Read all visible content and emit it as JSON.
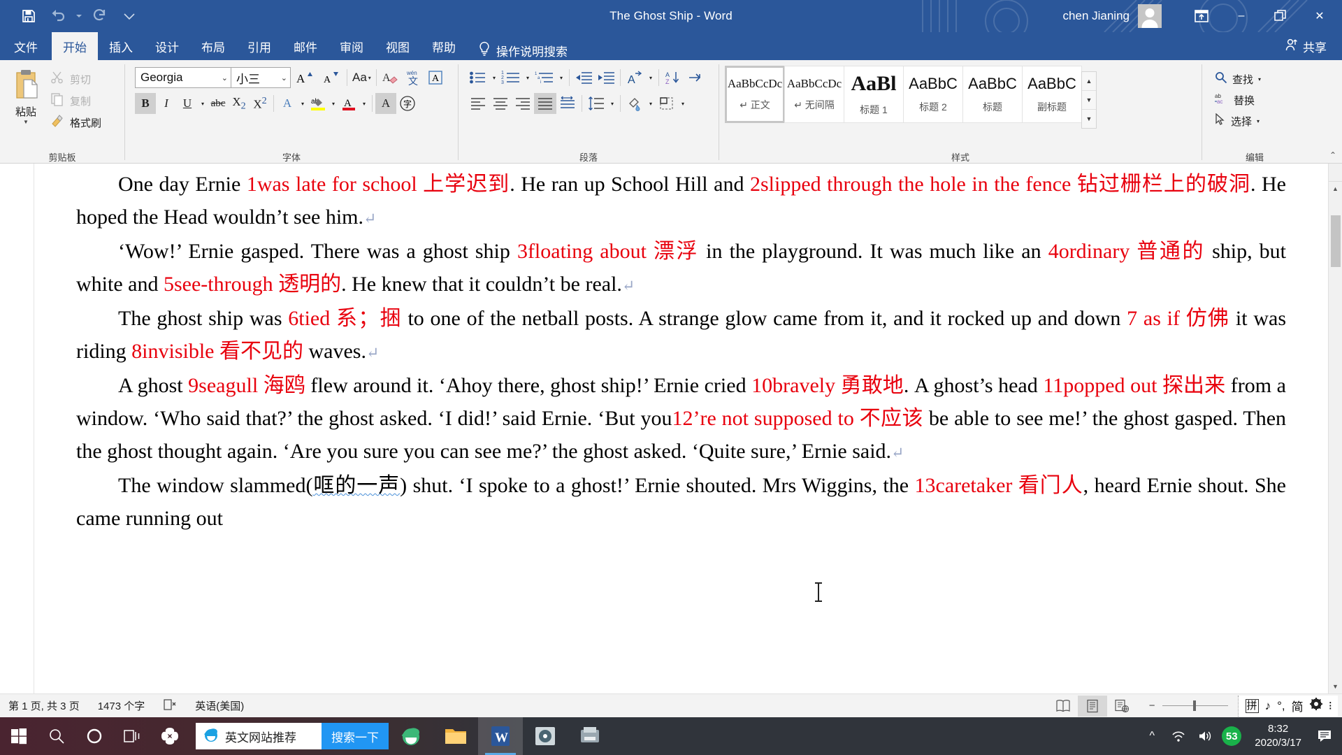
{
  "titlebar": {
    "quick_access": [
      {
        "name": "save",
        "icon": "save-icon"
      },
      {
        "name": "undo",
        "icon": "undo-icon"
      },
      {
        "name": "redo",
        "icon": "redo-icon"
      },
      {
        "name": "customize",
        "icon": "chevron-down-icon"
      }
    ],
    "document_title": "The Ghost Ship",
    "title_separator": "-",
    "app_name": "Word",
    "account_name": "chen Jianing",
    "ribbon_display_options": "ribbon-options-icon",
    "minimize": "–",
    "restore": "restore-icon",
    "close": "✕"
  },
  "tabs": [
    {
      "label": "文件",
      "active": false
    },
    {
      "label": "开始",
      "active": true
    },
    {
      "label": "插入",
      "active": false
    },
    {
      "label": "设计",
      "active": false
    },
    {
      "label": "布局",
      "active": false
    },
    {
      "label": "引用",
      "active": false
    },
    {
      "label": "邮件",
      "active": false
    },
    {
      "label": "审阅",
      "active": false
    },
    {
      "label": "视图",
      "active": false
    },
    {
      "label": "帮助",
      "active": false
    }
  ],
  "tell_me": "操作说明搜索",
  "share_label": "共享",
  "ribbon": {
    "clipboard": {
      "group_label": "剪贴板",
      "paste_label": "粘贴",
      "items": [
        {
          "label": "剪切",
          "icon": "scissors-icon",
          "enabled": false
        },
        {
          "label": "复制",
          "icon": "copy-icon",
          "enabled": false
        },
        {
          "label": "格式刷",
          "icon": "format-painter-icon",
          "enabled": true
        }
      ]
    },
    "font": {
      "group_label": "字体",
      "font_name": "Georgia",
      "font_size": "小三",
      "buttons_row1": [
        {
          "name": "grow-font",
          "glyph": "A▴"
        },
        {
          "name": "shrink-font",
          "glyph": "A▾"
        },
        {
          "name": "change-case",
          "glyph": "Aa"
        },
        {
          "name": "clear-formatting",
          "glyph": "A"
        },
        {
          "name": "phonetic-guide",
          "glyph": "文"
        },
        {
          "name": "character-border",
          "glyph": "A"
        }
      ],
      "buttons_row2": [
        {
          "name": "bold",
          "glyph": "B",
          "active": true
        },
        {
          "name": "italic",
          "glyph": "I",
          "active": false
        },
        {
          "name": "underline",
          "glyph": "U",
          "active": false
        },
        {
          "name": "strikethrough",
          "glyph": "abc",
          "active": false
        },
        {
          "name": "subscript",
          "glyph": "X₂",
          "active": false
        },
        {
          "name": "superscript",
          "glyph": "X²",
          "active": false
        },
        {
          "name": "text-effects",
          "glyph": "A",
          "active": false
        },
        {
          "name": "text-highlight-color",
          "glyph": "ab",
          "active": false
        },
        {
          "name": "font-color",
          "glyph": "A",
          "active": false
        },
        {
          "name": "character-shading",
          "glyph": "A",
          "active": true
        },
        {
          "name": "enclose-characters",
          "glyph": "字",
          "active": false
        }
      ]
    },
    "paragraph": {
      "group_label": "段落",
      "row1": [
        {
          "name": "bullets",
          "glyph": "bullets-icon"
        },
        {
          "name": "numbering",
          "glyph": "numbering-icon"
        },
        {
          "name": "multilevel-list",
          "glyph": "multilevel-icon"
        },
        {
          "name": "decrease-indent",
          "glyph": "decrease-indent-icon"
        },
        {
          "name": "increase-indent",
          "glyph": "increase-indent-icon"
        },
        {
          "name": "asian-layout",
          "glyph": "asian-layout-icon"
        },
        {
          "name": "sort",
          "glyph": "sort-icon"
        },
        {
          "name": "show-formatting-marks",
          "glyph": "pilcrow-icon"
        }
      ],
      "row2": [
        {
          "name": "align-left",
          "glyph": "align-left-icon",
          "active": false
        },
        {
          "name": "align-center",
          "glyph": "align-center-icon",
          "active": false
        },
        {
          "name": "align-right",
          "glyph": "align-right-icon",
          "active": false
        },
        {
          "name": "justify",
          "glyph": "justify-icon",
          "active": true
        },
        {
          "name": "distributed",
          "glyph": "distributed-icon",
          "active": false
        },
        {
          "name": "line-spacing",
          "glyph": "line-spacing-icon",
          "active": false
        },
        {
          "name": "shading",
          "glyph": "shading-icon",
          "active": false
        },
        {
          "name": "borders",
          "glyph": "borders-icon",
          "active": false
        }
      ]
    },
    "styles": {
      "group_label": "样式",
      "items": [
        {
          "preview": "AaBbCcDc",
          "name": "↵ 正文",
          "selected": true,
          "kind": "serif"
        },
        {
          "preview": "AaBbCcDc",
          "name": "↵ 无间隔",
          "selected": false,
          "kind": "serif"
        },
        {
          "preview": "AaBl",
          "name": "标题 1",
          "selected": false,
          "kind": "bigserif"
        },
        {
          "preview": "AaBbC",
          "name": "标题 2",
          "selected": false,
          "kind": "sans"
        },
        {
          "preview": "AaBbC",
          "name": "标题",
          "selected": false,
          "kind": "sans"
        },
        {
          "preview": "AaBbC",
          "name": "副标题",
          "selected": false,
          "kind": "sans"
        }
      ]
    },
    "editing": {
      "group_label": "编辑",
      "items": [
        {
          "label": "查找",
          "icon": "search-icon",
          "has_dropdown": true
        },
        {
          "label": "替换",
          "icon": "replace-icon",
          "has_dropdown": false
        },
        {
          "label": "选择",
          "icon": "cursor-icon",
          "has_dropdown": true
        }
      ]
    }
  },
  "document": {
    "paragraphs": [
      [
        {
          "t": "One day Ernie ",
          "c": "k"
        },
        {
          "t": "1was late for school 上学迟到",
          "c": "r"
        },
        {
          "t": ". He ran up School Hill and ",
          "c": "k"
        },
        {
          "t": "2slipped through the hole in the fence 钻过栅栏上的破洞",
          "c": "r"
        },
        {
          "t": ". He hoped the Head wouldn’t see him.",
          "c": "k"
        },
        {
          "t": "↵",
          "c": "p"
        }
      ],
      [
        {
          "t": "‘Wow!’ Ernie gasped. There was a ghost ship ",
          "c": "k"
        },
        {
          "t": "3floating about 漂浮",
          "c": "r"
        },
        {
          "t": "  in the playground. It was much like an ",
          "c": "k"
        },
        {
          "t": "4ordinary 普通的",
          "c": "r"
        },
        {
          "t": "  ship, but white and ",
          "c": "k"
        },
        {
          "t": "5see-through 透明的",
          "c": "r"
        },
        {
          "t": ". He knew that it couldn’t be real.",
          "c": "k"
        },
        {
          "t": "↵",
          "c": "p"
        }
      ],
      [
        {
          "t": "The ghost ship was ",
          "c": "k"
        },
        {
          "t": "6tied 系；捆",
          "c": "r"
        },
        {
          "t": "  to one of the netball posts. A strange glow came from it, and it rocked up and down ",
          "c": "k"
        },
        {
          "t": "7 as if 仿佛",
          "c": "r"
        },
        {
          "t": "  it was riding ",
          "c": "k"
        },
        {
          "t": "8invisible 看不见的",
          "c": "r"
        },
        {
          "t": " waves.",
          "c": "k"
        },
        {
          "t": "↵",
          "c": "p"
        }
      ],
      [
        {
          "t": "A ghost ",
          "c": "k"
        },
        {
          "t": "9seagull 海鸥",
          "c": "r"
        },
        {
          "t": "  flew around it. ‘Ahoy there, ghost ship!’ Ernie cried ",
          "c": "k"
        },
        {
          "t": "10bravely 勇敢地",
          "c": "r"
        },
        {
          "t": ". A ghost’s head ",
          "c": "k"
        },
        {
          "t": "11popped out 探出来",
          "c": "r"
        },
        {
          "t": " from a window. ‘Who said that?’ the ghost asked. ‘I did!’ said Ernie. ‘But you",
          "c": "k"
        },
        {
          "t": "12’re not supposed to 不应该",
          "c": "r"
        },
        {
          "t": "  be able to see me!’ the ghost gasped. Then the ghost thought again. ‘Are you sure you can see me?’ the ghost asked. ‘Quite sure,’ Ernie said.",
          "c": "k"
        },
        {
          "t": "↵",
          "c": "p"
        }
      ],
      [
        {
          "t": "The window slammed(",
          "c": "k"
        },
        {
          "t": "哐的一声",
          "c": "s"
        },
        {
          "t": ") shut. ‘I spoke to a ghost!’ Ernie shouted. Mrs Wiggins, the ",
          "c": "k"
        },
        {
          "t": "13caretaker 看门人",
          "c": "r"
        },
        {
          "t": ", heard Ernie shout. She came running out",
          "c": "k"
        }
      ]
    ]
  },
  "statusbar": {
    "page_info": "第 1 页, 共 3 页",
    "word_count": "1473 个字",
    "proofing_icon": "proofing-icon",
    "language": "英语(美国)",
    "views": [
      {
        "name": "read-mode",
        "active": false
      },
      {
        "name": "print-layout",
        "active": true
      },
      {
        "name": "web-layout",
        "active": false
      }
    ],
    "zoom_minus": "−",
    "zoom_plus": "+",
    "ime": [
      "拼",
      "♪",
      "°,",
      "简",
      "🈯",
      "⁝"
    ]
  },
  "taskbar": {
    "start": "windows-logo-icon",
    "search": "search-icon",
    "cortana": "cortana-icon",
    "task_view": "task-view-icon",
    "pinned_sogou": "sogou-icon",
    "search_box": {
      "browser_icon": "ie-icon",
      "text": "英文网站推荐",
      "button": "搜索一下"
    },
    "apps": [
      {
        "name": "internet-explorer",
        "active": false
      },
      {
        "name": "file-explorer",
        "active": false
      },
      {
        "name": "word",
        "active": true
      },
      {
        "name": "media-player",
        "active": false
      },
      {
        "name": "scanner",
        "active": false
      }
    ],
    "tray": {
      "show_hidden": "^",
      "network": "wifi-icon",
      "volume": "volume-icon",
      "battery_level": "53",
      "time": "8:32",
      "date": "2020/3/17",
      "notifications": "notification-icon"
    }
  },
  "colors": {
    "word_blue": "#2b579a",
    "red_text": "#e8000d",
    "accent_blue": "#2196f3",
    "battery_green": "#19b24a"
  }
}
